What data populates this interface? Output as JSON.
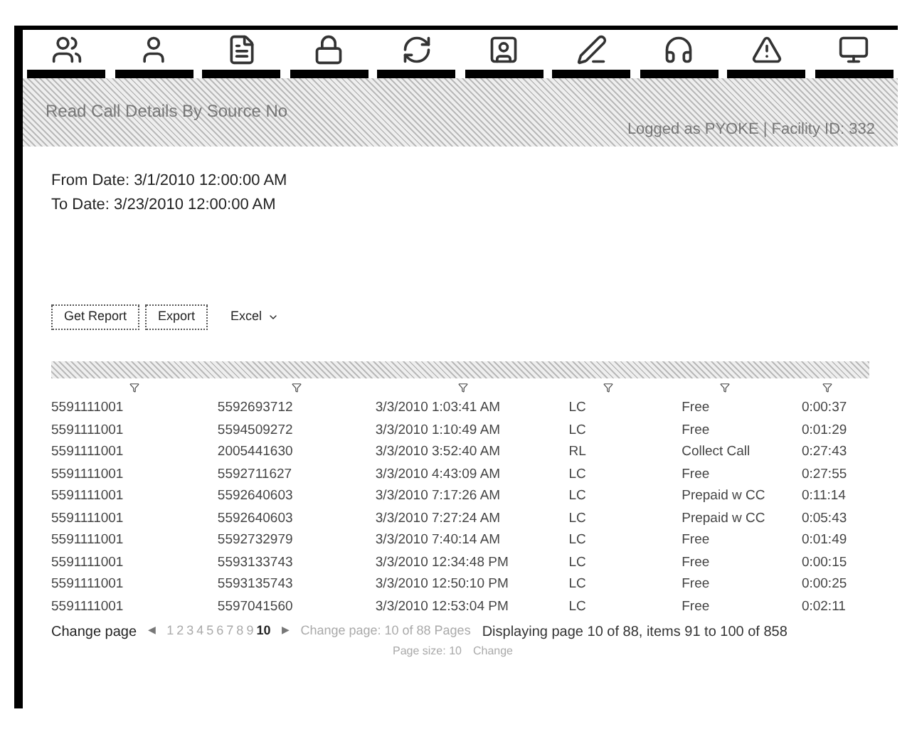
{
  "page_title": "Read Call Details By Source No",
  "login": "Logged as PYOKE | Facility ID: 332",
  "from_date": "From Date: 3/1/2010 12:00:00 AM",
  "to_date": "To Date: 3/23/2010 12:00:00 AM",
  "buttons": [
    "Get Report",
    "Export"
  ],
  "format": "Excel",
  "table": {
    "rows": [
      [
        "5591111001",
        "5592693712",
        "3/3/2010 1:03:41 AM",
        "LC",
        "Free",
        "0:00:37"
      ],
      [
        "5591111001",
        "5594509272",
        "3/3/2010 1:10:49 AM",
        "LC",
        "Free",
        "0:01:29"
      ],
      [
        "5591111001",
        "2005441630",
        "3/3/2010 3:52:40 AM",
        "RL",
        "Collect Call",
        "0:27:43"
      ],
      [
        "5591111001",
        "5592711627",
        "3/3/2010 4:43:09 AM",
        "LC",
        "Free",
        "0:27:55"
      ],
      [
        "5591111001",
        "5592640603",
        "3/3/2010 7:17:26 AM",
        "LC",
        "Prepaid w CC",
        "0:11:14"
      ],
      [
        "5591111001",
        "5592640603",
        "3/3/2010 7:27:24 AM",
        "LC",
        "Prepaid w CC",
        "0:05:43"
      ],
      [
        "5591111001",
        "5592732979",
        "3/3/2010 7:40:14 AM",
        "LC",
        "Free",
        "0:01:49"
      ],
      [
        "5591111001",
        "5593133743",
        "3/3/2010 12:34:48 PM",
        "LC",
        "Free",
        "0:00:15"
      ],
      [
        "5591111001",
        "5593135743",
        "3/3/2010 12:50:10 PM",
        "LC",
        "Free",
        "0:00:25"
      ],
      [
        "5591111001",
        "5597041560",
        "3/3/2010 12:53:04 PM",
        "LC",
        "Free",
        "0:02:11"
      ]
    ]
  },
  "pager": {
    "label": "Change page",
    "prev": "◀",
    "next": "▶",
    "pages": [
      {
        "label": "1",
        "selected": false
      },
      {
        "label": "2",
        "selected": false
      },
      {
        "label": "3",
        "selected": false
      },
      {
        "label": "4",
        "selected": false
      },
      {
        "label": "5",
        "selected": false
      },
      {
        "label": "6",
        "selected": false
      },
      {
        "label": "7",
        "selected": false
      },
      {
        "label": "8",
        "selected": false
      },
      {
        "label": "9",
        "selected": false
      },
      {
        "label": "10",
        "selected": true
      }
    ],
    "goto": "Change page: 10 of 88 Pages",
    "info": "Displaying page 10 of 88, items 91 to 100 of 858",
    "size": "Page size: 10",
    "change": "Change"
  }
}
